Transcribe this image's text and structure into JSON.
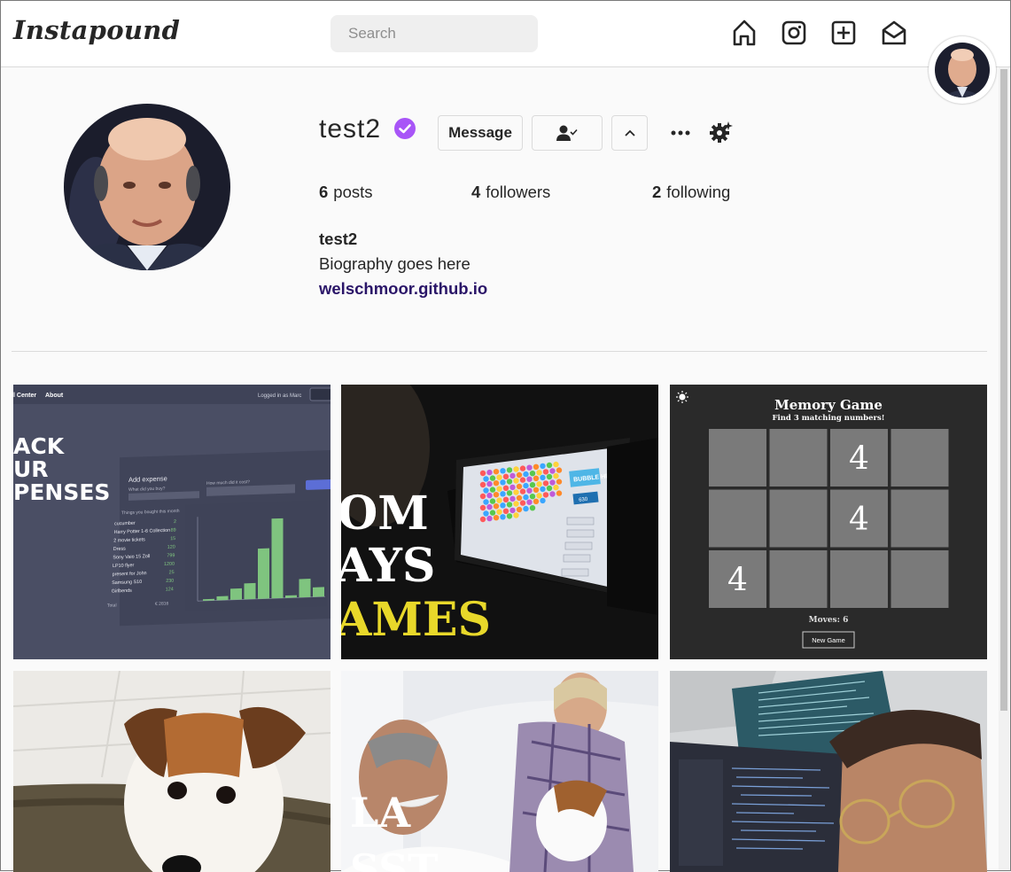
{
  "header": {
    "logo": "Instapound",
    "search_placeholder": "Search",
    "icons": [
      "home-icon",
      "instagram-icon",
      "add-post-icon",
      "messages-icon"
    ]
  },
  "profile": {
    "username": "test2",
    "verified_color": "#a855f7",
    "message_label": "Message",
    "stats": {
      "posts_count": "6",
      "posts_label": "posts",
      "followers_count": "4",
      "followers_label": "followers",
      "following_count": "2",
      "following_label": "following"
    },
    "bio_name": "test2",
    "bio_text": "Biography goes here",
    "website": "welschmoor.github.io"
  },
  "posts": {
    "post1": {
      "nav_left": "l Center",
      "nav_about": "About",
      "logged_in": "Logged in as Marc",
      "big_lines": [
        "ACK",
        "UR",
        "PENSES"
      ],
      "panel_title": "Add expense",
      "panel_question": "What did you buy?",
      "panel_amount": "How much did it cost?",
      "list_heading": "Things you bought this month",
      "items": [
        {
          "name": "cucumber",
          "value": "2"
        },
        {
          "name": "Harry Potter 1-6 Collection",
          "value": "89"
        },
        {
          "name": "2 movie tickets",
          "value": "15"
        },
        {
          "name": "Dress",
          "value": "120"
        },
        {
          "name": "Sony Vaio 15 Zoll",
          "value": "799"
        },
        {
          "name": "LP10 flyer",
          "value": "1200"
        },
        {
          "name": "present for John",
          "value": "25"
        },
        {
          "name": "Samsung S10",
          "value": "230"
        },
        {
          "name": "Girlbends",
          "value": "124"
        }
      ],
      "total_label": "Total",
      "total_value": "€ 2816",
      "bar_values": [
        0.02,
        0.05,
        0.14,
        0.2,
        0.63,
        1.0,
        0.03,
        0.23,
        0.12
      ]
    },
    "post2": {
      "lines": [
        "OM",
        "AYS",
        "AMES"
      ],
      "game_title": "BUBBLE HIT",
      "score": "630"
    },
    "post3": {
      "title": "Memory Game",
      "subtitle": "Find 3 matching numbers!",
      "cells": [
        "",
        "",
        "4",
        "",
        "",
        "",
        "4",
        "",
        "4",
        "",
        "",
        ""
      ],
      "moves": "Moves: 6",
      "new_game": "New Game"
    },
    "post5": {
      "lines": [
        "LA",
        "SST"
      ]
    }
  },
  "colors": {
    "link": "#2a1568",
    "border": "#dbdbdb",
    "memory_bg": "#2a2a2a",
    "memory_cell": "#7a7a7a",
    "bar_green": "#7fc47f"
  }
}
